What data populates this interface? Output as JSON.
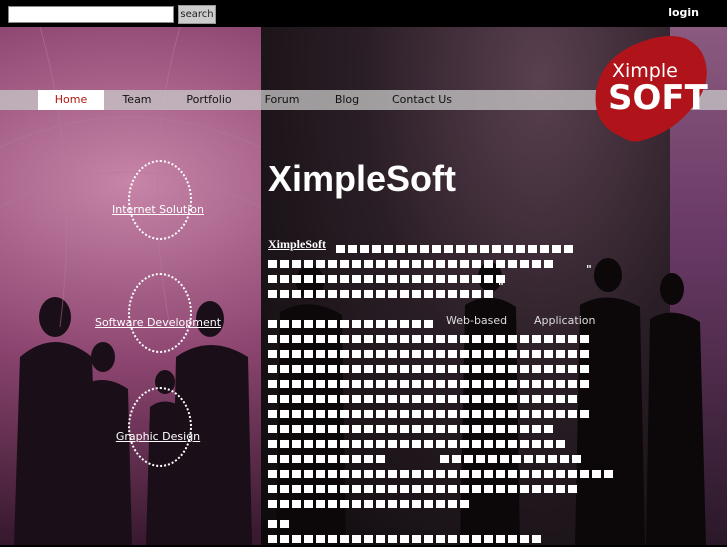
{
  "search": {
    "placeholder": "",
    "button_label": "search"
  },
  "account": {
    "login_label": "login"
  },
  "nav": {
    "items": [
      {
        "label": "Home",
        "active": true
      },
      {
        "label": "Team",
        "active": false
      },
      {
        "label": "Portfolio",
        "active": false
      },
      {
        "label": "Forum",
        "active": false
      },
      {
        "label": "Blog",
        "active": false
      },
      {
        "label": "Contact Us",
        "active": false
      }
    ]
  },
  "logo": {
    "line1": "Ximple",
    "line2": "SOFT",
    "accent": "#b0141a"
  },
  "services": [
    {
      "label": "Internet Solution"
    },
    {
      "label": "Software Development"
    },
    {
      "label": "Graphic Design"
    }
  ],
  "main": {
    "title": "XimpleSoft",
    "intro_label": "XimpleSoft",
    "quote_open": "\"",
    "quote_close": "\"",
    "word_web": "Web-based",
    "word_app": "Application"
  },
  "colors": {
    "active_nav_text": "#b01515",
    "nav_bg": "#c8c8c8"
  }
}
